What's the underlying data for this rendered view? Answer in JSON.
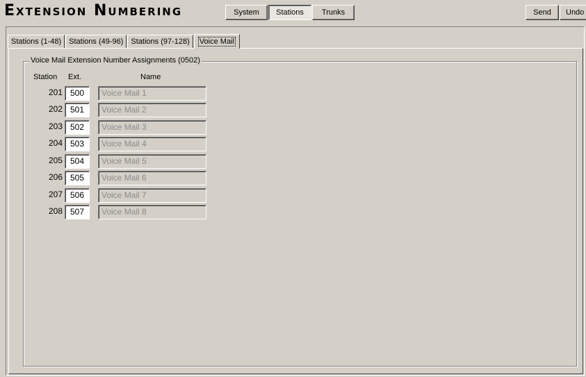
{
  "header": {
    "title": "Extension Numbering",
    "buttons": {
      "system": "System",
      "stations": "Stations",
      "trunks": "Trunks",
      "send": "Send",
      "undo": "Undo"
    }
  },
  "tabs": [
    {
      "label": "Stations (1-48)"
    },
    {
      "label": "Stations (49-96)"
    },
    {
      "label": "Stations (97-128)"
    },
    {
      "label": "Voice Mail"
    }
  ],
  "active_tab": "Voice Mail",
  "group": {
    "title": "Voice Mail Extension Number Assignments (0502)",
    "columns": {
      "station": "Station",
      "ext": "Ext.",
      "name": "Name"
    },
    "rows": [
      {
        "station": "201",
        "ext": "500",
        "name": "Voice Mail 1"
      },
      {
        "station": "202",
        "ext": "501",
        "name": "Voice Mail 2"
      },
      {
        "station": "203",
        "ext": "502",
        "name": "Voice Mail 3"
      },
      {
        "station": "204",
        "ext": "503",
        "name": "Voice Mail 4"
      },
      {
        "station": "205",
        "ext": "504",
        "name": "Voice Mail 5"
      },
      {
        "station": "206",
        "ext": "505",
        "name": "Voice Mail 6"
      },
      {
        "station": "207",
        "ext": "506",
        "name": "Voice Mail 7"
      },
      {
        "station": "208",
        "ext": "507",
        "name": "Voice Mail 8"
      }
    ]
  },
  "colors": {
    "face": "#d4d0c8",
    "disabled_text": "#8a8a8a",
    "field_bg": "#ffffff"
  }
}
